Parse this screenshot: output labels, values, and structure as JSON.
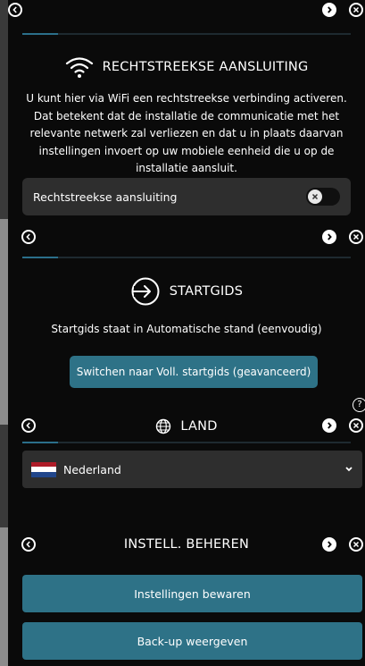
{
  "wifi_panel": {
    "title": "RECHTSTREEKSE AANSLUITING",
    "description": "U kunt hier via WiFi een rechtstreekse verbinding activeren. Dat betekent dat de installatie de communicatie met het relevante netwerk zal verliezen en dat u in plaats daarvan instellingen invoert op uw mobiele eenheid die u op de installatie aansluit.",
    "toggle_label": "Rechtstreekse aansluiting",
    "toggle_on": false,
    "icon": "wifi-icon"
  },
  "startgids_panel": {
    "title": "STARTGIDS",
    "status": "Startgids staat in Automatische stand (eenvoudig)",
    "switch_button": "Switchen naar Voll. startgids (geavanceerd)",
    "icon": "sign-in-icon"
  },
  "land_panel": {
    "title": "LAND",
    "selected_country": "Nederland",
    "icon": "globe-icon"
  },
  "instell_panel": {
    "title": "INSTELL. BEHEREN",
    "save_button": "Instellingen bewaren",
    "backup_button": "Back-up weergeven"
  },
  "colors": {
    "accent": "#2e7287",
    "panel_bg": "#0a0a0a",
    "row_bg": "#2e2e2e",
    "flag_red": "#ae1c28",
    "flag_white": "#ffffff",
    "flag_blue": "#21468b"
  }
}
